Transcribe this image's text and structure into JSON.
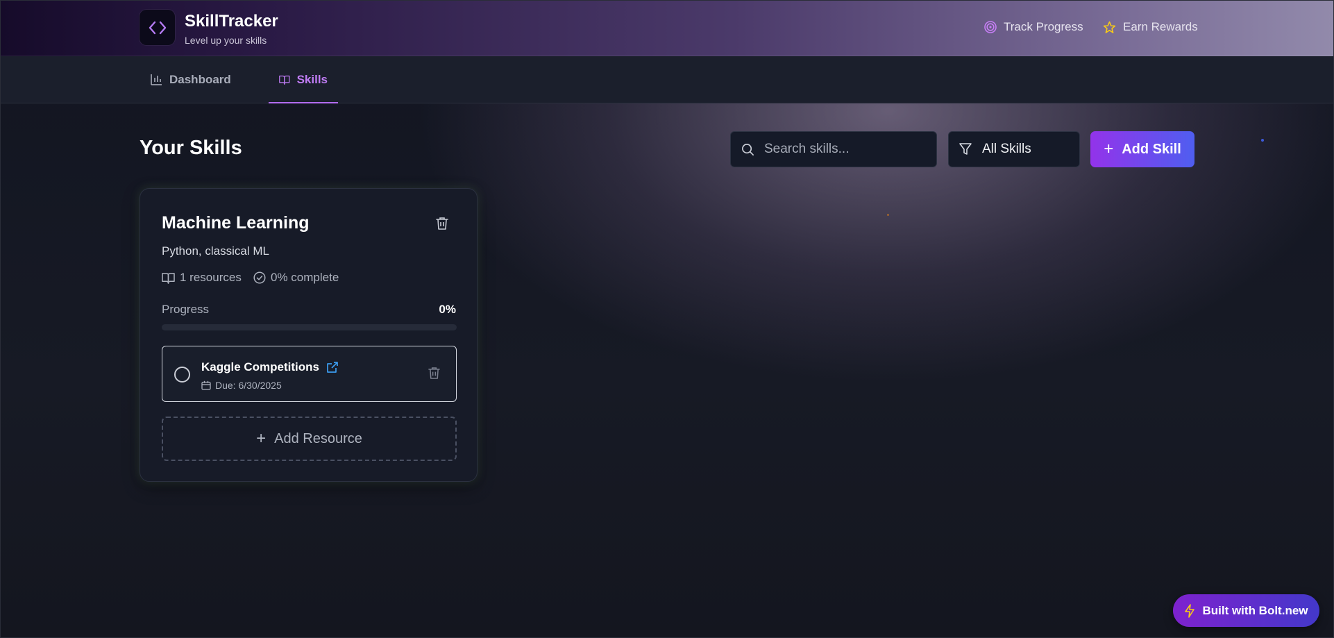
{
  "header": {
    "brand_title": "SkillTracker",
    "brand_subtitle": "Level up your skills",
    "links": [
      {
        "label": "Track Progress",
        "icon": "target-icon"
      },
      {
        "label": "Earn Rewards",
        "icon": "star-icon"
      }
    ]
  },
  "nav": {
    "tabs": [
      {
        "label": "Dashboard",
        "icon": "bar-chart-icon",
        "active": false
      },
      {
        "label": "Skills",
        "icon": "book-open-icon",
        "active": true
      }
    ]
  },
  "main": {
    "title": "Your Skills",
    "search_placeholder": "Search skills...",
    "search_value": "",
    "filter_label": "All Skills",
    "add_skill_label": "Add Skill"
  },
  "skills": [
    {
      "title": "Machine Learning",
      "description": "Python, classical ML",
      "resources_count": "1 resources",
      "complete_text": "0% complete",
      "progress_label": "Progress",
      "progress_text": "0%",
      "progress_fraction": 0,
      "resources": [
        {
          "name": "Kaggle Competitions",
          "due": "Due: 6/30/2025",
          "done": false
        }
      ],
      "add_resource_label": "Add Resource"
    }
  ],
  "badge": {
    "label": "Built with Bolt.new"
  },
  "colors": {
    "accent": "#9333ea",
    "accent_blue": "#4f5ef0",
    "active_tab": "#c07cf5",
    "link_icon": "#3b9cf0",
    "star": "#facc15"
  }
}
